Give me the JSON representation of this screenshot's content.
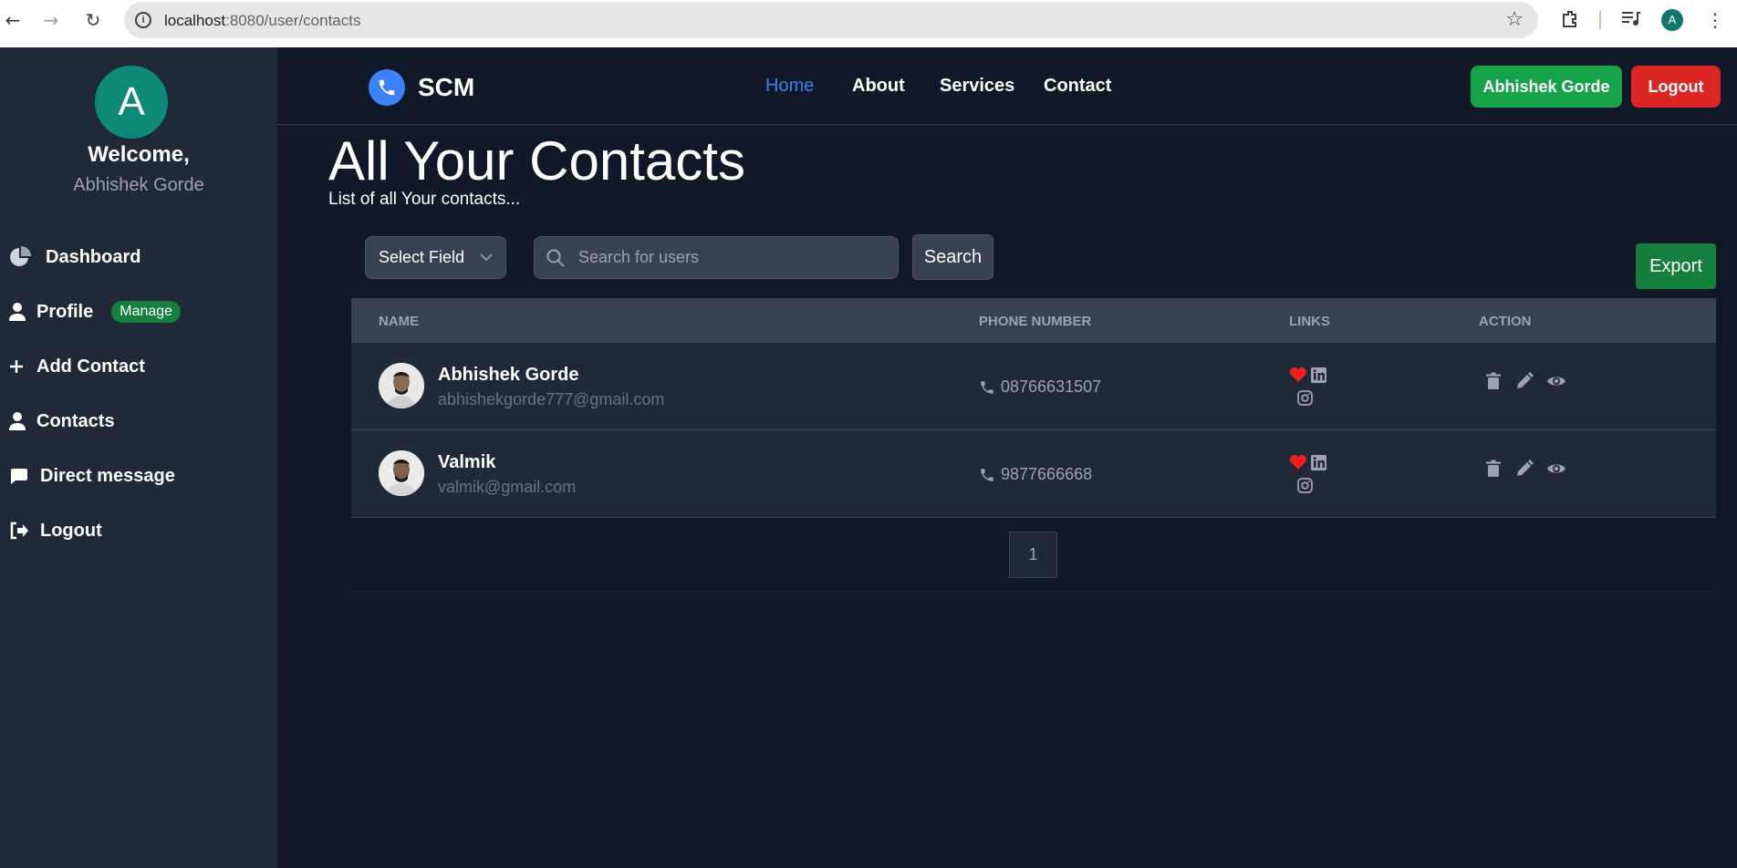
{
  "browser": {
    "url_host": "localhost",
    "url_rest": ":8080/user/contacts",
    "profile_initial": "A"
  },
  "sidebar": {
    "avatar_initial": "A",
    "welcome": "Welcome,",
    "username": "Abhishek Gorde",
    "items": [
      {
        "label": "Dashboard",
        "icon": "pie-chart-icon"
      },
      {
        "label": "Profile",
        "icon": "user-icon",
        "badge": "Manage"
      },
      {
        "label": "Add Contact",
        "icon": "plus-icon"
      },
      {
        "label": "Contacts",
        "icon": "user-icon"
      },
      {
        "label": "Direct message",
        "icon": "message-icon"
      },
      {
        "label": "Logout",
        "icon": "logout-icon"
      }
    ]
  },
  "nav": {
    "brand": "SCM",
    "links": [
      "Home",
      "About",
      "Services",
      "Contact"
    ],
    "active": "Home",
    "user_button": "Abhishek Gorde",
    "logout_button": "Logout"
  },
  "main": {
    "title": "All Your Contacts",
    "subtitle": "List of all Your contacts...",
    "select_field": "Select Field",
    "search_placeholder": "Search for users",
    "search_button": "Search",
    "export_button": "Export"
  },
  "table": {
    "headers": [
      "NAME",
      "PHONE NUMBER",
      "LINKS",
      "ACTION"
    ],
    "rows": [
      {
        "name": "Abhishek Gorde",
        "email": "abhishekgorde777@gmail.com",
        "phone": "08766631507",
        "favorite": true
      },
      {
        "name": "Valmik",
        "email": "valmik@gmail.com",
        "phone": "9877666668",
        "favorite": true
      }
    ]
  },
  "pagination": {
    "current_page": "1"
  },
  "colors": {
    "page_bg": "#111827",
    "sidebar_bg": "#1f2937",
    "accent_blue": "#3b82f6",
    "green": "#16a34a",
    "red": "#dc2626",
    "heart": "#ef1f1f"
  }
}
